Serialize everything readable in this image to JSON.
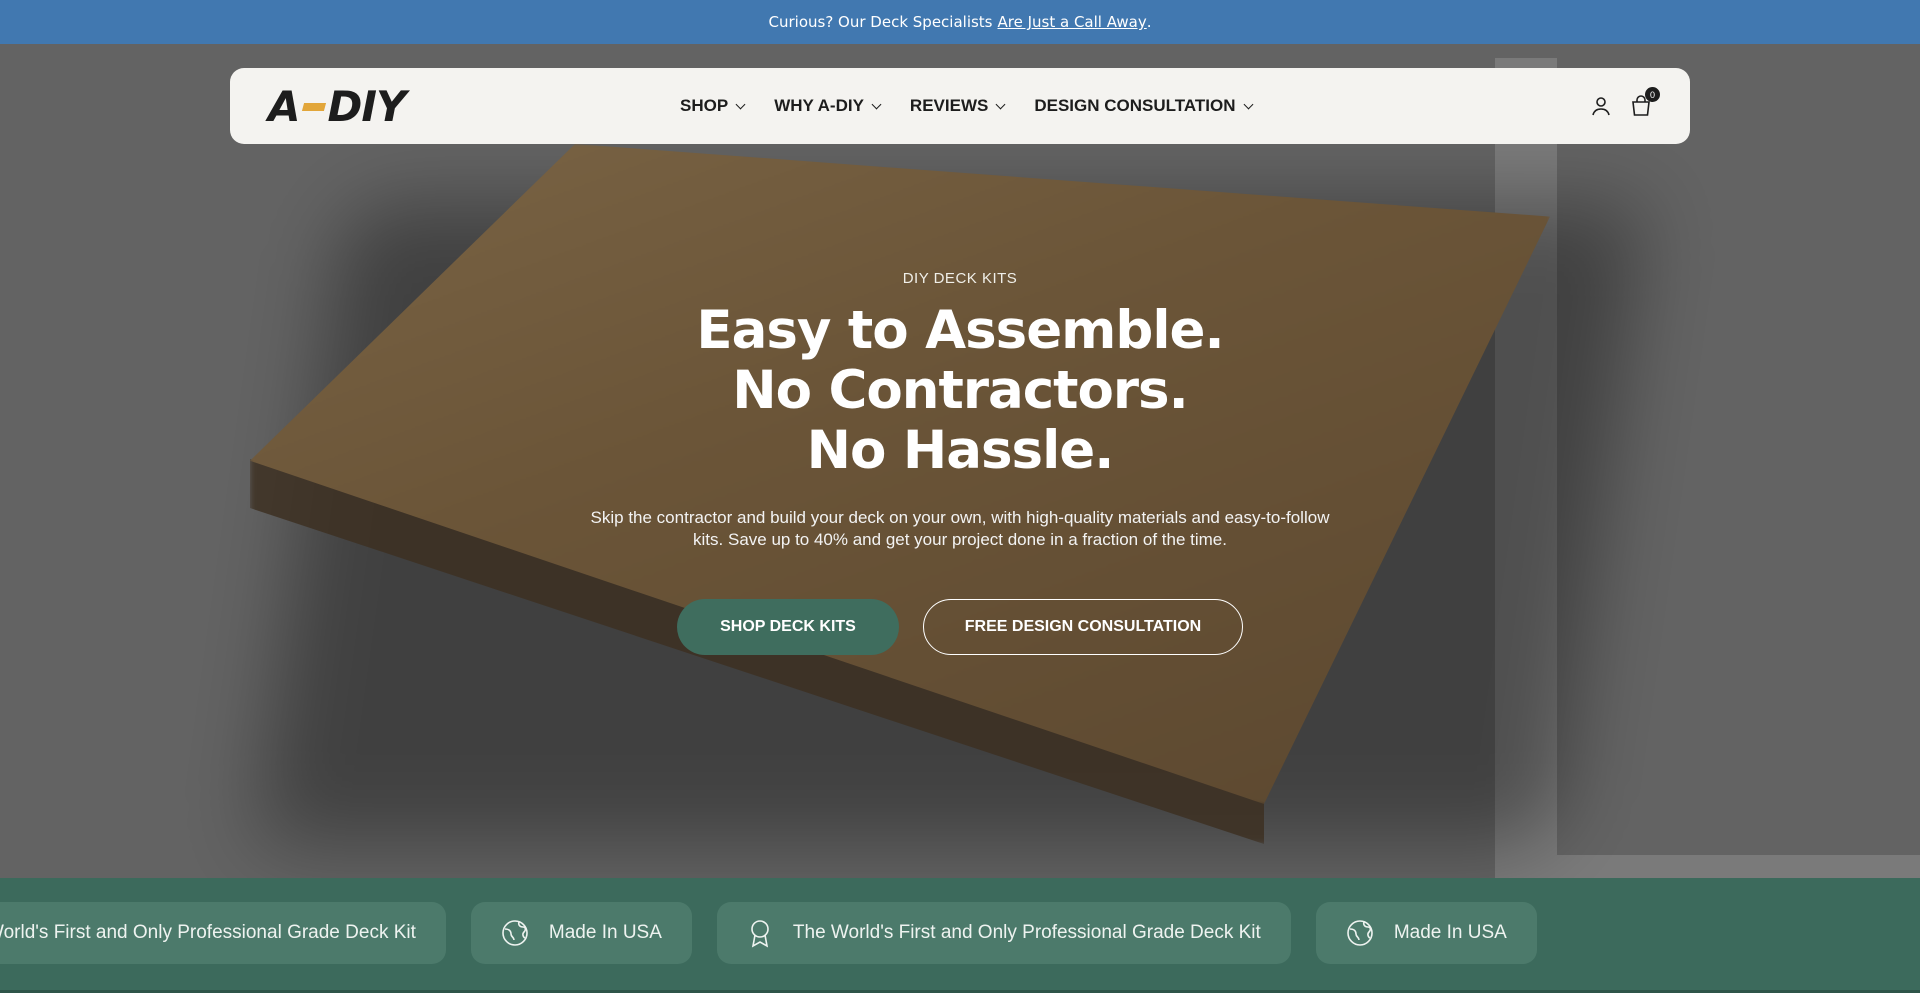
{
  "announcement": {
    "text": "Curious? Our Deck Specialists",
    "link": "Are Just a Call Away",
    "suffix": "."
  },
  "header": {
    "logo_left": "A",
    "logo_right": "DIY",
    "nav": [
      {
        "label": "SHOP"
      },
      {
        "label": "WHY A-DIY"
      },
      {
        "label": "REVIEWS"
      },
      {
        "label": "DESIGN CONSULTATION"
      }
    ],
    "cart_count": "0"
  },
  "hero": {
    "eyebrow": "DIY DECK KITS",
    "headline_1": "Easy to Assemble.",
    "headline_2": "No Contractors.",
    "headline_3": "No Hassle.",
    "subtext": "Skip the contractor and build your deck on your own, with high-quality materials and easy-to-follow kits. Save up to 40% and get your project done in a fraction of the time.",
    "primary_cta": "SHOP DECK KITS",
    "secondary_cta": "FREE DESIGN CONSULTATION"
  },
  "features": [
    {
      "label": "The World's First and Only Professional Grade Deck Kit",
      "icon": "award-icon"
    },
    {
      "label": "Made In USA",
      "icon": "globe-icon"
    },
    {
      "label": "The World's First and Only Professional Grade Deck Kit",
      "icon": "award-icon"
    },
    {
      "label": "Made In USA",
      "icon": "globe-icon"
    }
  ],
  "colors": {
    "announcement_bg": "#4178b0",
    "primary_green": "#3f6d5e",
    "strip_green": "#3c6a5c",
    "header_bg": "#f4f3f0"
  }
}
